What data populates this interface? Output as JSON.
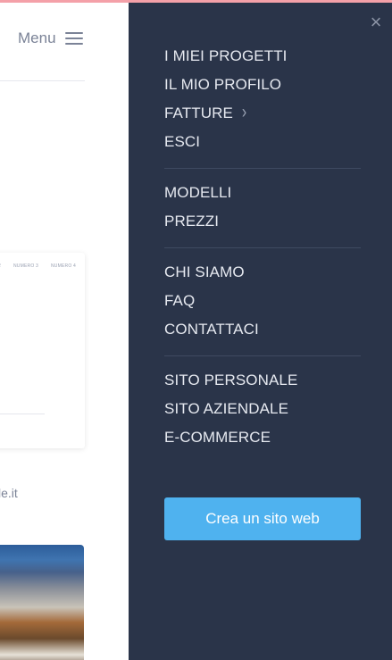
{
  "header": {
    "menu_label": "Menu"
  },
  "background_page": {
    "card_column_labels": [
      "2",
      "NUMERO 3",
      "NUMERO 4"
    ],
    "domain_fragment": "le.it"
  },
  "panel": {
    "close_symbol": "×",
    "groups": [
      {
        "items": [
          {
            "label": "I MIEI PROGETTI",
            "has_submenu": false
          },
          {
            "label": "IL MIO PROFILO",
            "has_submenu": false
          },
          {
            "label": "FATTURE",
            "has_submenu": true
          },
          {
            "label": "ESCI",
            "has_submenu": false
          }
        ]
      },
      {
        "items": [
          {
            "label": "MODELLI",
            "has_submenu": false
          },
          {
            "label": "PREZZI",
            "has_submenu": false
          }
        ]
      },
      {
        "items": [
          {
            "label": "CHI SIAMO",
            "has_submenu": false
          },
          {
            "label": "FAQ",
            "has_submenu": false
          },
          {
            "label": "CONTATTACI",
            "has_submenu": false
          }
        ]
      },
      {
        "items": [
          {
            "label": "SITO PERSONALE",
            "has_submenu": false
          },
          {
            "label": "SITO AZIENDALE",
            "has_submenu": false
          },
          {
            "label": "E-COMMERCE",
            "has_submenu": false
          }
        ]
      }
    ],
    "cta_label": "Crea un sito web"
  },
  "colors": {
    "panel_bg": "#2a3449",
    "cta_bg": "#4fb2ef",
    "menu_text": "#e6e9f0",
    "muted_text": "#7b8397"
  },
  "icons": {
    "menu": "hamburger-icon",
    "close": "close-icon",
    "submenu": "chevron-right-icon"
  }
}
